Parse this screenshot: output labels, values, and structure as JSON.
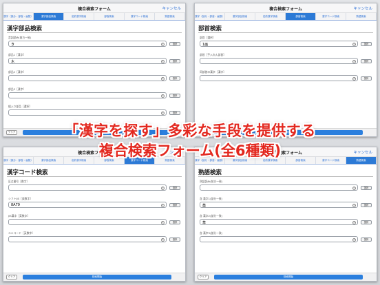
{
  "nav": {
    "title": "複合検索フォーム",
    "cancel": "キャンセル"
  },
  "tabs": [
    "漢字（部分・部首・画数）",
    "漢字部品検索",
    "名前漢字検索",
    "部首検索",
    "漢字コード検索",
    "熟語検索"
  ],
  "buttons": {
    "select": "選択",
    "clear": "クリア",
    "search": "検索開始"
  },
  "banner": {
    "line1": "「漢字を探す」多彩な手段を提供する",
    "line2": "複合検索フォーム(全6種類)"
  },
  "panels": [
    {
      "active_tab": 1,
      "section_title": "漢字部品検索",
      "fields": [
        {
          "label": "音訓読み(前方一致)",
          "value": "き"
        },
        {
          "label": "部品1［漢字］",
          "value": "木"
        },
        {
          "label": "部品2［漢字］",
          "value": ""
        },
        {
          "label": "部品3［漢字］",
          "value": ""
        },
        {
          "label": "組入り部品［選択］",
          "value": ""
        }
      ]
    },
    {
      "active_tab": 3,
      "section_title": "部首検索",
      "fields": [
        {
          "label": "部首［選択］",
          "value": "1画"
        },
        {
          "label": "部首［手入れん部首］",
          "value": ""
        },
        {
          "label": "同部首の漢字［漢字］",
          "value": ""
        }
      ]
    },
    {
      "active_tab": 4,
      "section_title": "漢字コード検索",
      "fields": [
        {
          "label": "区点番号［数字］",
          "value": ""
        },
        {
          "label": "シフトJIS［英数字］",
          "value": "8A79"
        },
        {
          "label": "JIS漢字［英数字］",
          "value": ""
        },
        {
          "label": "ユニコード［英数字］",
          "value": ""
        }
      ]
    },
    {
      "active_tab": 5,
      "section_title": "熟語検索",
      "fields": [
        {
          "label": "熟語読み(前方一致)",
          "value": ""
        },
        {
          "label": "含 漢字1(部分一致)",
          "value": "薬"
        },
        {
          "label": "含 漢字2(部分一致)",
          "value": "草"
        },
        {
          "label": "含 漢字3(部分一致)",
          "value": ""
        }
      ]
    }
  ]
}
